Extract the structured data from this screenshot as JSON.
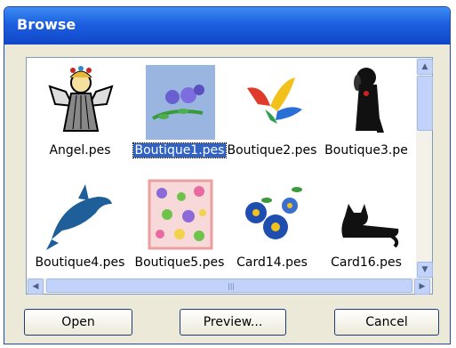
{
  "window": {
    "title": "Browse"
  },
  "files": [
    {
      "name": "Angel.pes",
      "icon": "angel-embroidery-icon",
      "selected": false
    },
    {
      "name": "Boutique1.pes",
      "icon": "flowers-embroidery-icon",
      "selected": true
    },
    {
      "name": "Boutique2.pes",
      "icon": "bird-embroidery-icon",
      "selected": false
    },
    {
      "name": "Boutique3.pe",
      "icon": "dog-embroidery-icon",
      "selected": false
    },
    {
      "name": "Boutique4.pes",
      "icon": "dolphin-embroidery-icon",
      "selected": false
    },
    {
      "name": "Boutique5.pes",
      "icon": "floral-pattern-embroidery-icon",
      "selected": false
    },
    {
      "name": "Card14.pes",
      "icon": "blue-flowers-embroidery-icon",
      "selected": false
    },
    {
      "name": "Card16.pes",
      "icon": "cat-embroidery-icon",
      "selected": false
    }
  ],
  "buttons": {
    "open": "Open",
    "preview": "Preview...",
    "cancel": "Cancel"
  },
  "colors": {
    "selection": "#3163c5",
    "title_bar": "#1d5fe0"
  }
}
